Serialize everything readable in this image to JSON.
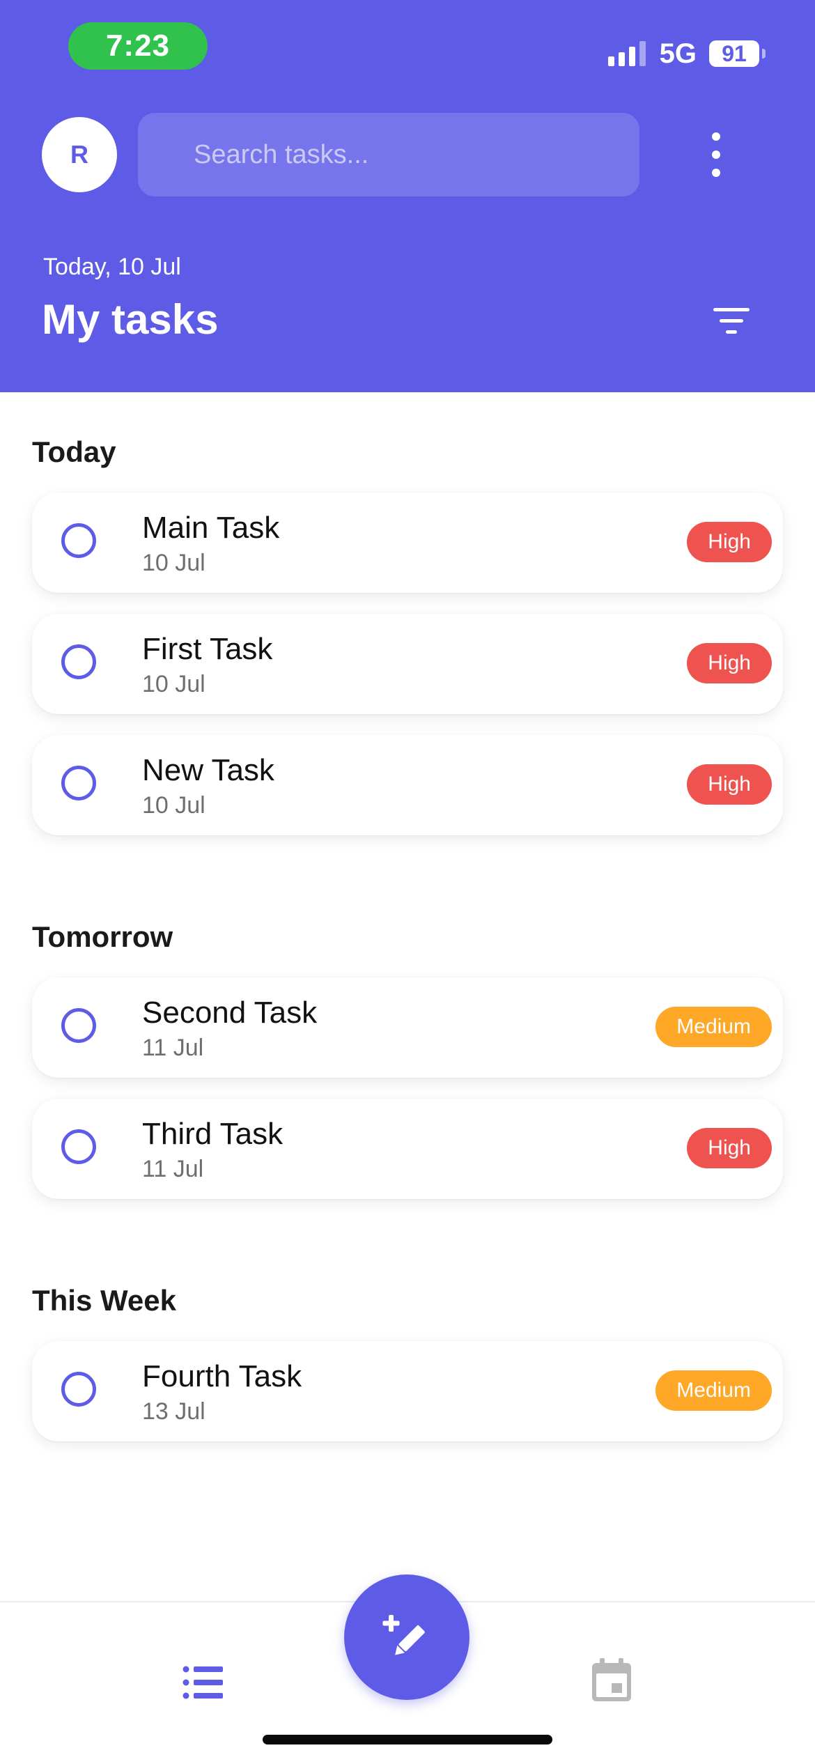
{
  "status_bar": {
    "time": "7:23",
    "network": "5G",
    "battery": "91"
  },
  "header": {
    "avatar_initial": "R",
    "search_placeholder": "Search tasks...",
    "date": "Today, 10 Jul",
    "title": "My tasks"
  },
  "sections": [
    {
      "title": "Today",
      "tasks": [
        {
          "name": "Main Task",
          "date": "10 Jul",
          "priority": "High"
        },
        {
          "name": "First Task",
          "date": "10 Jul",
          "priority": "High"
        },
        {
          "name": "New Task",
          "date": "10 Jul",
          "priority": "High"
        }
      ]
    },
    {
      "title": "Tomorrow",
      "tasks": [
        {
          "name": "Second Task",
          "date": "11 Jul",
          "priority": "Medium"
        },
        {
          "name": "Third Task",
          "date": "11 Jul",
          "priority": "High"
        }
      ]
    },
    {
      "title": "This Week",
      "tasks": [
        {
          "name": "Fourth Task",
          "date": "13 Jul",
          "priority": "Medium"
        }
      ]
    }
  ],
  "colors": {
    "primary": "#5E5CE6",
    "high": "#EF5350",
    "medium": "#FFA726",
    "time_pill": "#30C24C"
  },
  "icons": {
    "more": "more-vertical-icon",
    "filter": "filter-icon",
    "list": "list-icon",
    "add": "edit-add-icon",
    "calendar": "calendar-icon"
  }
}
